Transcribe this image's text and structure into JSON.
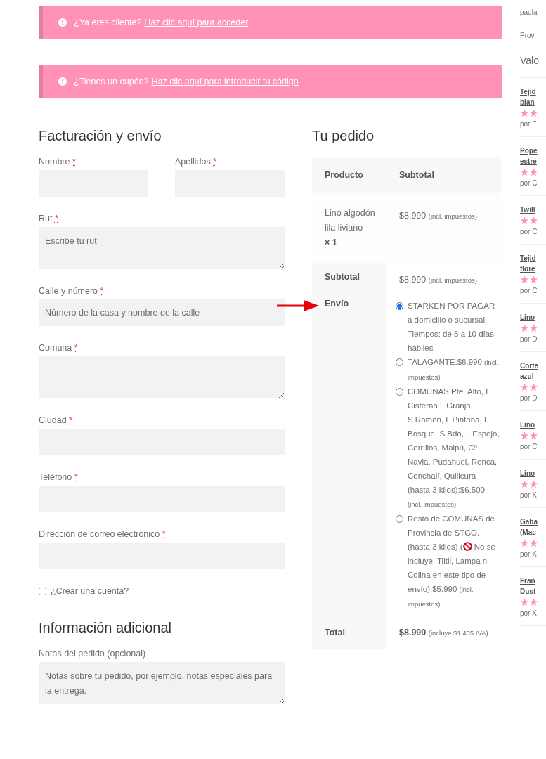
{
  "notices": [
    {
      "text": "¿Ya eres cliente?",
      "link": "Haz clic aquí para acceder"
    },
    {
      "text": "¿Tienes un cupón?",
      "link": "Haz clic aquí para introducir tu código"
    }
  ],
  "billing": {
    "title": "Facturación y envío",
    "fields": [
      {
        "kind": "half",
        "label": "Nombre",
        "required": "*"
      },
      {
        "kind": "half",
        "label": "Apellidos",
        "required": "*"
      },
      {
        "kind": "textarea",
        "label": "Rut",
        "required": "*",
        "placeholder": "Escribe tu rut"
      },
      {
        "kind": "input",
        "label": "Calle y número",
        "required": "*",
        "placeholder": "Número de la casa y nombre de la calle"
      },
      {
        "kind": "textarea",
        "label": "Comuna",
        "required": "*"
      },
      {
        "kind": "input",
        "label": "Ciudad",
        "required": "*"
      },
      {
        "kind": "input",
        "label": "Teléfono",
        "required": "*"
      },
      {
        "kind": "input",
        "label": "Dirección de correo electrónico",
        "required": "*"
      }
    ],
    "create_account": {
      "label": "¿Crear una cuenta?",
      "checked": false
    }
  },
  "additional": {
    "title": "Información adicional",
    "label": "Notas del pedido (opcional)",
    "placeholder": "Notas sobre tu pedido, por ejemplo, notas especiales para la entrega."
  },
  "order": {
    "title": "Tu pedido",
    "columns": [
      "Producto",
      "Subtotal"
    ],
    "item": {
      "name": "Lino algodón lila liviano",
      "qty": "× 1",
      "price": "$8.990",
      "tax_note": "(incl. impuestos)"
    },
    "subtotal": {
      "label": "Subtotal",
      "price": "$8.990",
      "tax_note": "(incl. impuestos)"
    },
    "shipping": {
      "label": "Envío",
      "options": [
        {
          "label": "STARKEN POR PAGAR a domicilio o sucursal. Tiempos: de 5 a 10 días hábiles",
          "selected": true
        },
        {
          "label": "TALAGANTE:",
          "price": "$6.990",
          "tax_note": "(incl. impuestos)",
          "selected": false
        },
        {
          "label": "COMUNAS Pte. Alto, L Cisterna L Granja, S.Ramón, L Pintana, E Bosque, S.Bdo, L Espejo, Cerrillos, Maipú, Cº Navia, Pudahuel, Renca, Conchalí, Quilicura (hasta 3 kilos):",
          "price": "$6.500",
          "tax_note": "(incl. impuestos)",
          "selected": false
        },
        {
          "label": "Resto de COMUNAS de Provincia de STGO. (hasta 3 kilos) (",
          "label_after": "No se incluye, Tiltil, Lampa ni Colina en este tipo de envío):",
          "price": "$5.990",
          "tax_note": "(incl. impuestos)",
          "selected": false
        }
      ]
    },
    "total": {
      "label": "Total",
      "price": "$8.990",
      "tax_note": "(incluye $1.435 IVA)"
    }
  },
  "sidebar": {
    "lines": [
      "paula",
      "Prov"
    ],
    "heading": "Valo",
    "reviews": [
      {
        "title_lines": [
          "Tejid",
          "blan"
        ],
        "author": "por F"
      },
      {
        "title_lines": [
          "Pope",
          "estre"
        ],
        "author": "por C"
      },
      {
        "title_lines": [
          "Twill"
        ],
        "author": "por C"
      },
      {
        "title_lines": [
          "Tejid",
          "flore"
        ],
        "author": "por C"
      },
      {
        "title_lines": [
          "Lino"
        ],
        "author": "por D"
      },
      {
        "title_lines": [
          "Corte",
          "azul"
        ],
        "author": "por D"
      },
      {
        "title_lines": [
          "Lino"
        ],
        "author": "por C"
      },
      {
        "title_lines": [
          "Lino"
        ],
        "author": "por X"
      },
      {
        "title_lines": [
          "Gaba",
          "(Mac"
        ],
        "author": "por X"
      },
      {
        "title_lines": [
          "Fran",
          "Dust"
        ],
        "author": "por X"
      }
    ]
  }
}
